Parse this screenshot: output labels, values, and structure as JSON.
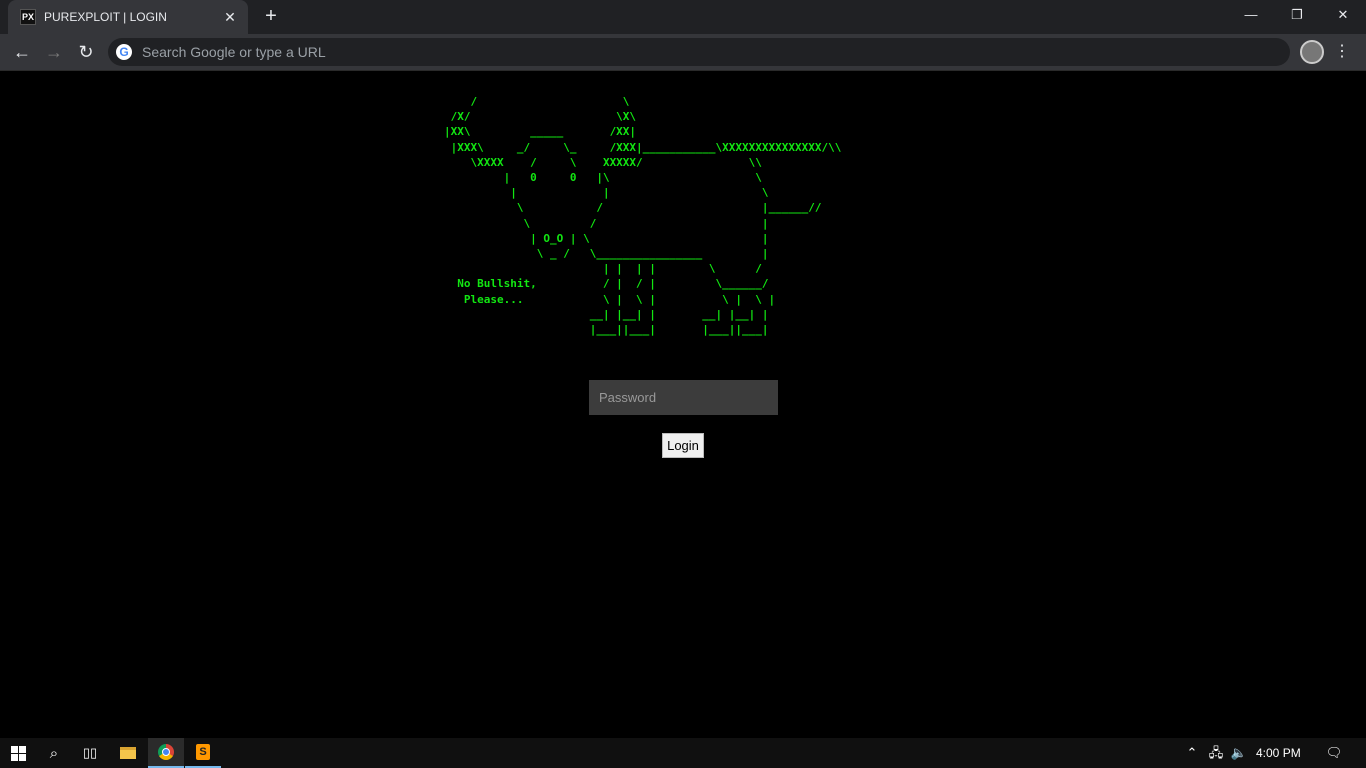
{
  "browser": {
    "tab": {
      "favicon_text": "PX",
      "title": "PUREXPLOIT | LOGIN"
    },
    "omnibox_placeholder": "Search Google or type a URL"
  },
  "page": {
    "ascii_art": "    /                      \\\n /X/                      \\X\\\n|XX\\         _____       /XX|\n |XXX\\     _/     \\_     /XXX|___________\\XXXXXXXXXXXXXXX/\\\\\n    \\XXXX    /     \\    XXXXX/                \\\\\n         |   0     0   |\\                      \\\n          |             |                       \\\n           \\           /                        |______//\n            \\         /                         |\n             | O_O | \\                          |\n              \\ _ /   \\________________         |\n                        | |  | |        \\      /\n  No Bullshit,          / |  / |         \\______/\n   Please...            \\ |  \\ |          \\ |  \\ |\n                      __| |__| |       __| |__| |\n                      |___||___|       |___||___|",
    "password_placeholder": "Password",
    "login_label": "Login"
  },
  "taskbar": {
    "icons": [
      "windows-start-icon",
      "search-icon",
      "task-view-icon",
      "file-explorer-icon",
      "chrome-icon",
      "sublime-text-icon"
    ],
    "clock": "4:00 PM"
  },
  "colors": {
    "ascii_green": "#12e612",
    "background": "#000000",
    "chrome_dark": "#202124"
  }
}
